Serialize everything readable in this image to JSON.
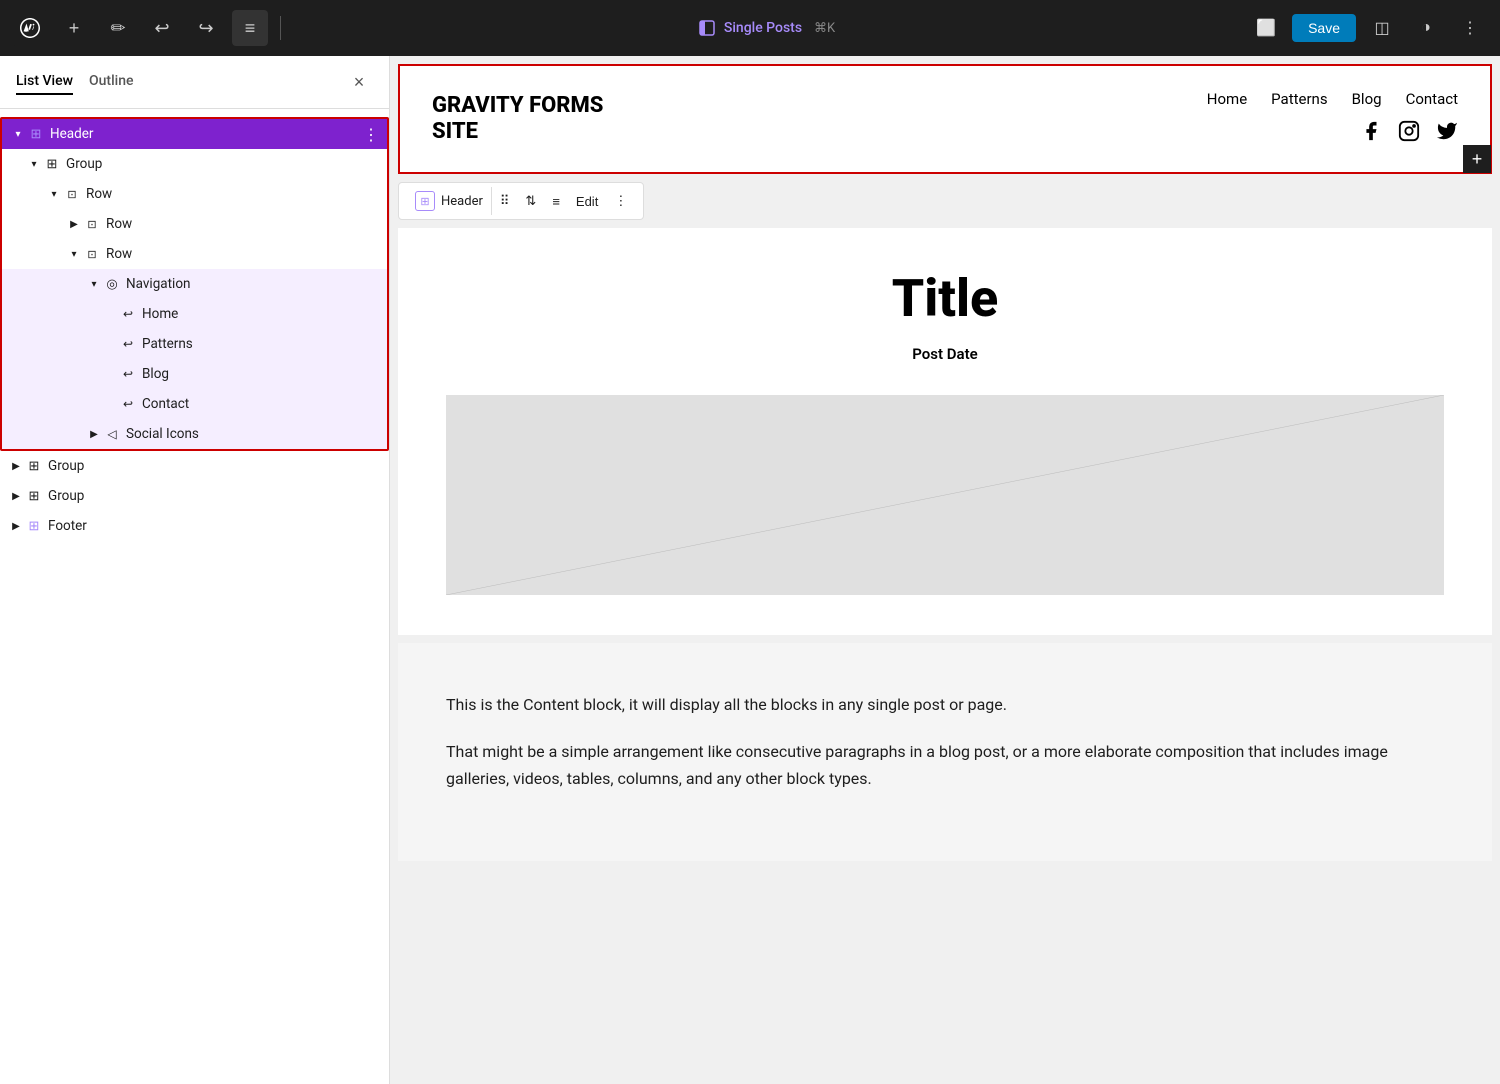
{
  "toolbar": {
    "save_label": "Save",
    "add_label": "+",
    "undo_label": "↩",
    "redo_label": "↪",
    "template_name": "Single Posts",
    "shortcut": "⌘K"
  },
  "panel": {
    "tab_list": "List View",
    "tab_outline": "Outline",
    "close_btn": "×"
  },
  "tree": {
    "items": [
      {
        "label": "Header",
        "level": 0,
        "type": "header",
        "selected": true,
        "chevron": "▾",
        "icon": "⊞"
      },
      {
        "label": "Group",
        "level": 1,
        "type": "group",
        "chevron": "▾",
        "icon": "⊞"
      },
      {
        "label": "Row",
        "level": 2,
        "type": "row",
        "chevron": "▾",
        "icon": "⊡"
      },
      {
        "label": "Row",
        "level": 3,
        "type": "row",
        "chevron": "▶",
        "icon": "⊡"
      },
      {
        "label": "Row",
        "level": 3,
        "type": "row",
        "chevron": "▾",
        "icon": "⊡"
      },
      {
        "label": "Navigation",
        "level": 4,
        "type": "navigation",
        "chevron": "▾",
        "icon": "◎"
      },
      {
        "label": "Home",
        "level": 5,
        "type": "nav-link",
        "icon": "↩"
      },
      {
        "label": "Patterns",
        "level": 5,
        "type": "nav-link",
        "icon": "↩"
      },
      {
        "label": "Blog",
        "level": 5,
        "type": "nav-link",
        "icon": "↩"
      },
      {
        "label": "Contact",
        "level": 5,
        "type": "nav-link",
        "icon": "↩"
      },
      {
        "label": "Social Icons",
        "level": 4,
        "type": "social-icons",
        "chevron": "▶",
        "icon": "◁"
      }
    ],
    "footer_items": [
      {
        "label": "Group",
        "level": 0,
        "type": "group",
        "chevron": "▶",
        "icon": "⊞"
      },
      {
        "label": "Group",
        "level": 0,
        "type": "group",
        "chevron": "▶",
        "icon": "⊞"
      },
      {
        "label": "Footer",
        "level": 0,
        "type": "footer",
        "chevron": "▶",
        "icon": "⊞"
      }
    ]
  },
  "header_preview": {
    "site_title_line1": "GRAVITY FORMS",
    "site_title_line2": "SITE",
    "nav_links": [
      "Home",
      "Patterns",
      "Blog",
      "Contact"
    ],
    "social_icons": [
      "f",
      "◎",
      "𝕏"
    ]
  },
  "block_toolbar": {
    "block_name": "Header",
    "edit_label": "Edit",
    "move_icon": "⠿"
  },
  "post_preview": {
    "title": "Title",
    "date": "Post Date"
  },
  "content_block": {
    "paragraph1": "This is the Content block, it will display all the blocks in any single post or page.",
    "paragraph2": "That might be a simple arrangement like consecutive paragraphs in a blog post, or a more elaborate composition that includes image galleries, videos, tables, columns, and any other block types."
  }
}
